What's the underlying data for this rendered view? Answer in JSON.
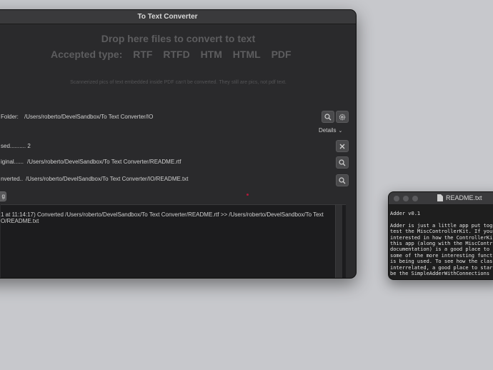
{
  "main_window": {
    "title": "To Text Converter",
    "drop_title": "Drop here files to convert to text",
    "accepted_label": "Accepted type:",
    "types": [
      "RTF",
      "RTFD",
      "HTM",
      "HTML",
      "PDF"
    ],
    "note": "Scannerized pics of text embedded inside PDF can't be converted. They still are pics, not pdf text.",
    "folder_label": "Folder:",
    "folder_path": "/Users/roberto/DevelSandbox/To Text Converter/IO",
    "details_label": "Details",
    "processed_label": "sed.......... 2",
    "original_label": "iginal......",
    "original_path": "/Users/roberto/DevelSandbox/To Text Converter/README.rtf",
    "converted_label": "nverted..",
    "converted_path": "/Users/roberto/DevelSandbox/To Text Converter/IO/README.txt",
    "small_button_label": "g",
    "log_line1": "1 at 11:14:17) Converted /Users/roberto/DevelSandbox/To Text Converter/README.rtf  >>  /Users/roberto/DevelSandbox/To Text",
    "log_line2": "O/README.txt"
  },
  "readme_window": {
    "title": "README.txt",
    "lines": [
      "Adder v0.1",
      "",
      "Adder is just a little app put tog",
      "test the MiscControllerKit. If you",
      "interested in how the ControllerKi",
      "this app (along with the MiscContr",
      "documentation) is a good place to",
      "some of the more interesting funct",
      "is being used. To see how the clas",
      "interrelated, a good place to star",
      "be the SimpleAdderWithConnections "
    ]
  }
}
